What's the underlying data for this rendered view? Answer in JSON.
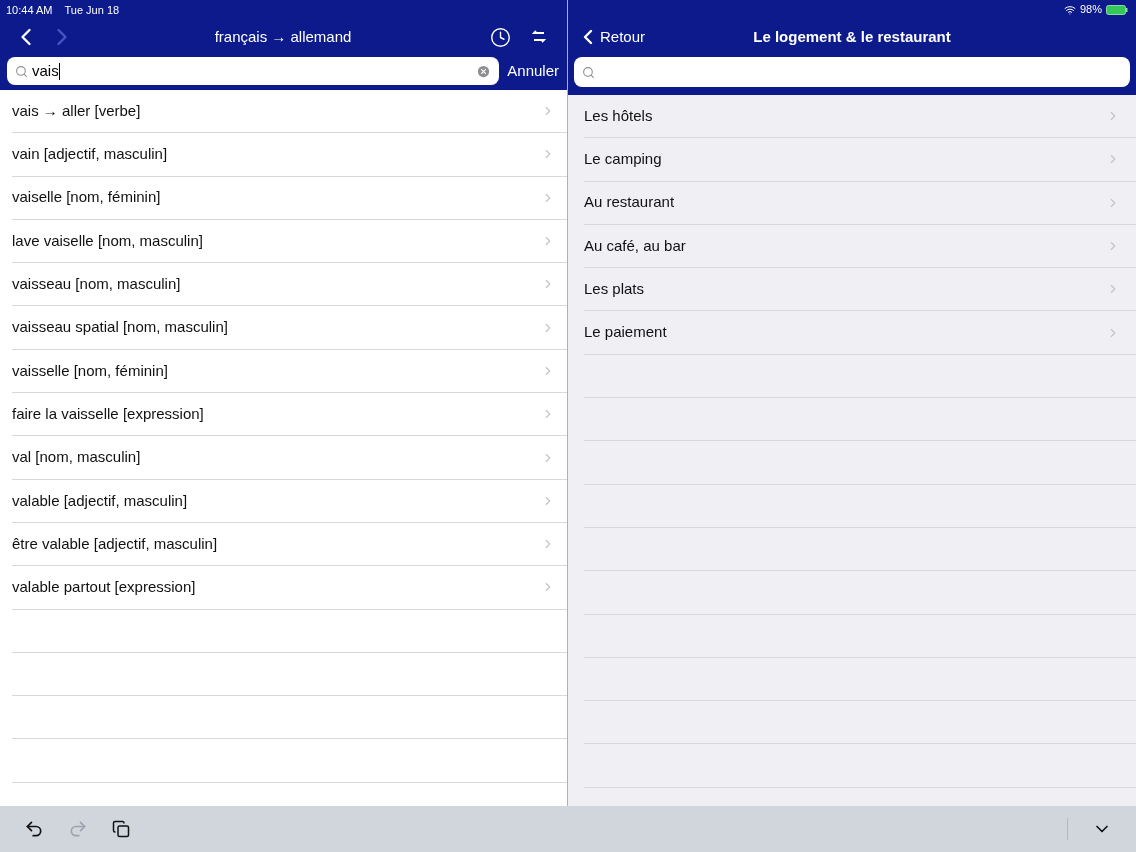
{
  "status_bar": {
    "time": "10:44 AM",
    "date": "Tue Jun 18",
    "battery": "98%"
  },
  "left": {
    "title": "français → allemand",
    "back_disabled": false,
    "forward_disabled": true,
    "search": {
      "value": "vais",
      "cancel": "Annuler"
    },
    "results": [
      "vais → aller [verbe]",
      "vain [adjectif, masculin]",
      "vaiselle [nom, féminin]",
      "lave vaiselle [nom, masculin]",
      "vaisseau [nom, masculin]",
      "vaisseau spatial [nom, masculin]",
      "vaisselle [nom, féminin]",
      "faire la vaisselle [expression]",
      "val [nom, masculin]",
      "valable [adjectif, masculin]",
      "être valable [adjectif, masculin]",
      "valable partout [expression]"
    ]
  },
  "right": {
    "back": "Retour",
    "title": "Le logement & le restaurant",
    "items": [
      "Les hôtels",
      "Le camping",
      "Au restaurant",
      "Au café, au bar",
      "Les plats",
      "Le paiement"
    ]
  },
  "toolbar": {
    "undo_disabled": false,
    "redo_disabled": true
  }
}
